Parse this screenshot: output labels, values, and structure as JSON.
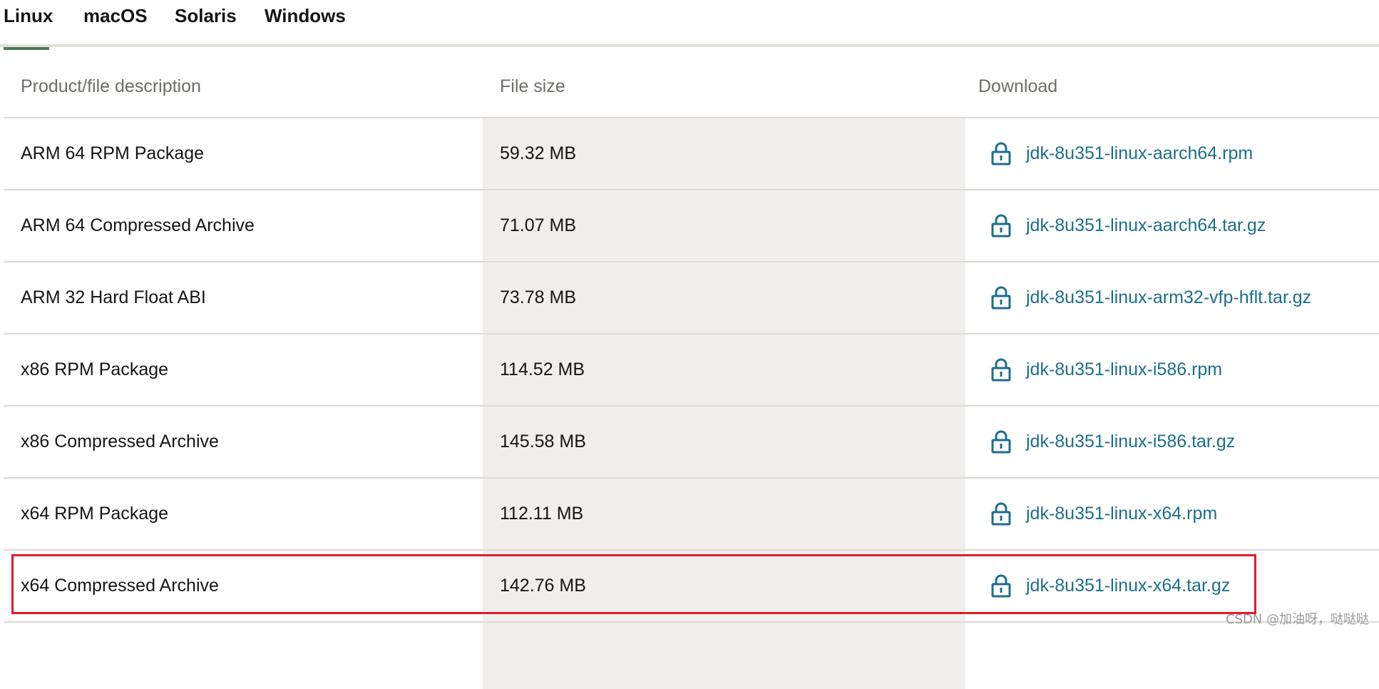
{
  "tabs": [
    {
      "label": "Linux",
      "active": true
    },
    {
      "label": "macOS",
      "active": false
    },
    {
      "label": "Solaris",
      "active": false
    },
    {
      "label": "Windows",
      "active": false
    }
  ],
  "table": {
    "headers": {
      "description": "Product/file description",
      "size": "File size",
      "download": "Download"
    },
    "rows": [
      {
        "description": "ARM 64 RPM Package",
        "size": "59.32 MB",
        "file": "jdk-8u351-linux-aarch64.rpm"
      },
      {
        "description": "ARM 64 Compressed Archive",
        "size": "71.07 MB",
        "file": "jdk-8u351-linux-aarch64.tar.gz"
      },
      {
        "description": "ARM 32 Hard Float ABI",
        "size": "73.78 MB",
        "file": "jdk-8u351-linux-arm32-vfp-hflt.tar.gz"
      },
      {
        "description": "x86 RPM Package",
        "size": "114.52 MB",
        "file": "jdk-8u351-linux-i586.rpm"
      },
      {
        "description": "x86 Compressed Archive",
        "size": "145.58 MB",
        "file": "jdk-8u351-linux-i586.tar.gz"
      },
      {
        "description": "x64 RPM Package",
        "size": "112.11 MB",
        "file": "jdk-8u351-linux-x64.rpm"
      },
      {
        "description": "x64 Compressed Archive",
        "size": "142.76 MB",
        "file": "jdk-8u351-linux-x64.tar.gz"
      }
    ]
  },
  "icons": {
    "download": "lock-icon"
  },
  "colors": {
    "accent_tab": "#4a7a56",
    "link": "#1c6f8a",
    "highlight": "#e21b2a",
    "column_shade": "#f1efed"
  },
  "watermark": "CSDN @加油呀，哒哒哒"
}
